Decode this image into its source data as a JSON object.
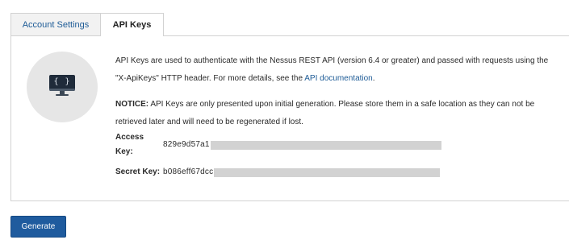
{
  "tabs": [
    {
      "label": "Account Settings",
      "active": false
    },
    {
      "label": "API Keys",
      "active": true
    }
  ],
  "icon": {
    "name": "api-monitor-icon",
    "glyph": "{ }"
  },
  "description": {
    "text_before_link": "API Keys are used to authenticate with the Nessus REST API (version 6.4 or greater) and passed with requests using the \"X-ApiKeys\" HTTP header. For more details, see the ",
    "link_text": "API documentation",
    "text_after_link": "."
  },
  "notice": {
    "label": "NOTICE:",
    "text": " API Keys are only presented upon initial generation. Please store them in a safe location as they can not be retrieved later and will need to be regenerated if lost."
  },
  "keys": {
    "access": {
      "label": "Access Key:",
      "value_visible": "829e9d57a1"
    },
    "secret": {
      "label": "Secret Key:",
      "value_visible": "b086eff67dcc"
    }
  },
  "actions": {
    "generate_label": "Generate"
  },
  "colors": {
    "accent": "#1f5b9e",
    "link": "#1d5b96",
    "redaction": "#d2d2d2",
    "icon_bg": "#e6e6e6"
  }
}
